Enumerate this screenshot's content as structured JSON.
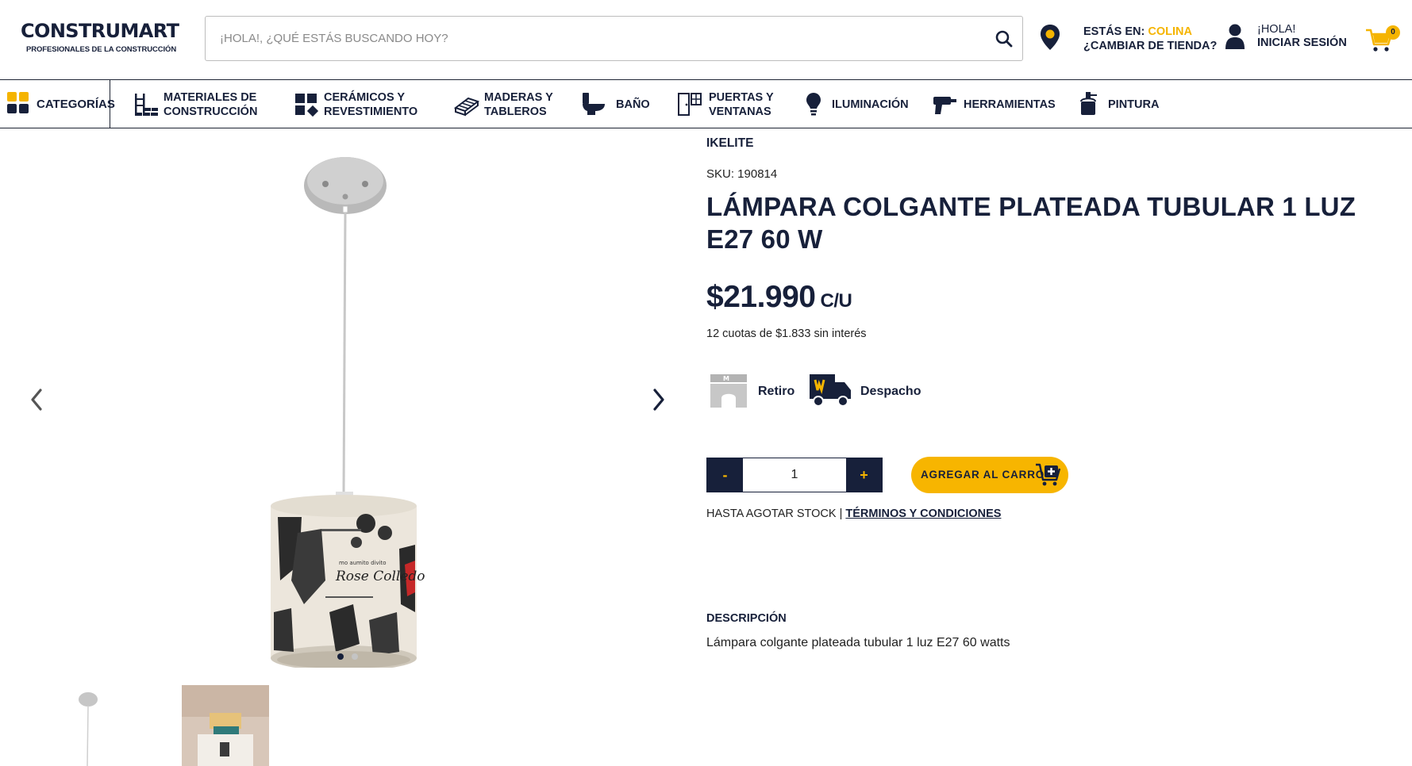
{
  "header": {
    "logo": "CONSTRUMART",
    "logo_tagline": "PROFESIONALES DE LA CONSTRUCCIÓN",
    "search_placeholder": "¡HOLA!, ¿QUÉ ESTÁS BUSCANDO HOY?",
    "store_label": "ESTÁS EN:",
    "store_name": "COLINA",
    "store_change": "¿CAMBIAR DE TIENDA?",
    "greeting": "¡HOLA!",
    "login": "INICIAR SESIÓN",
    "cart_count": "0"
  },
  "nav": {
    "categories": "CATEGORÍAS",
    "items": [
      {
        "line1": "MATERIALES DE",
        "line2": "CONSTRUCCIÓN"
      },
      {
        "line1": "CERÁMICOS Y",
        "line2": "REVESTIMIENTO"
      },
      {
        "line1": "MADERAS Y",
        "line2": "TABLEROS"
      },
      {
        "line1": "BAÑO",
        "line2": ""
      },
      {
        "line1": "PUERTAS Y",
        "line2": "VENTANAS"
      },
      {
        "line1": "ILUMINACIÓN",
        "line2": ""
      },
      {
        "line1": "HERRAMIENTAS",
        "line2": ""
      },
      {
        "line1": "PINTURA",
        "line2": ""
      }
    ]
  },
  "gallery": {
    "slide_count": 2,
    "active_slide": 1
  },
  "product": {
    "brand": "IKELITE",
    "sku": "SKU: 190814",
    "title": "LÁMPARA COLGANTE PLATEADA TUBULAR 1 LUZ E27 60 W",
    "price": "$21.990",
    "price_unit": "C/U",
    "installments": "12 cuotas de $1.833 sin interés",
    "pickup_label": "Retiro",
    "delivery_label": "Despacho",
    "quantity": "1",
    "qty_minus": "-",
    "qty_plus": "+",
    "add_to_cart": "AGREGAR AL CARRO",
    "stock_note": "HASTA AGOTAR STOCK |",
    "terms_link": "TÉRMINOS Y CONDICIONES",
    "description_heading": "DESCRIPCIÓN",
    "description": "Lámpara colgante plateada tubular 1 luz E27 60 watts"
  },
  "colors": {
    "navy": "#17203a",
    "accent_yellow": "#f5b400"
  }
}
